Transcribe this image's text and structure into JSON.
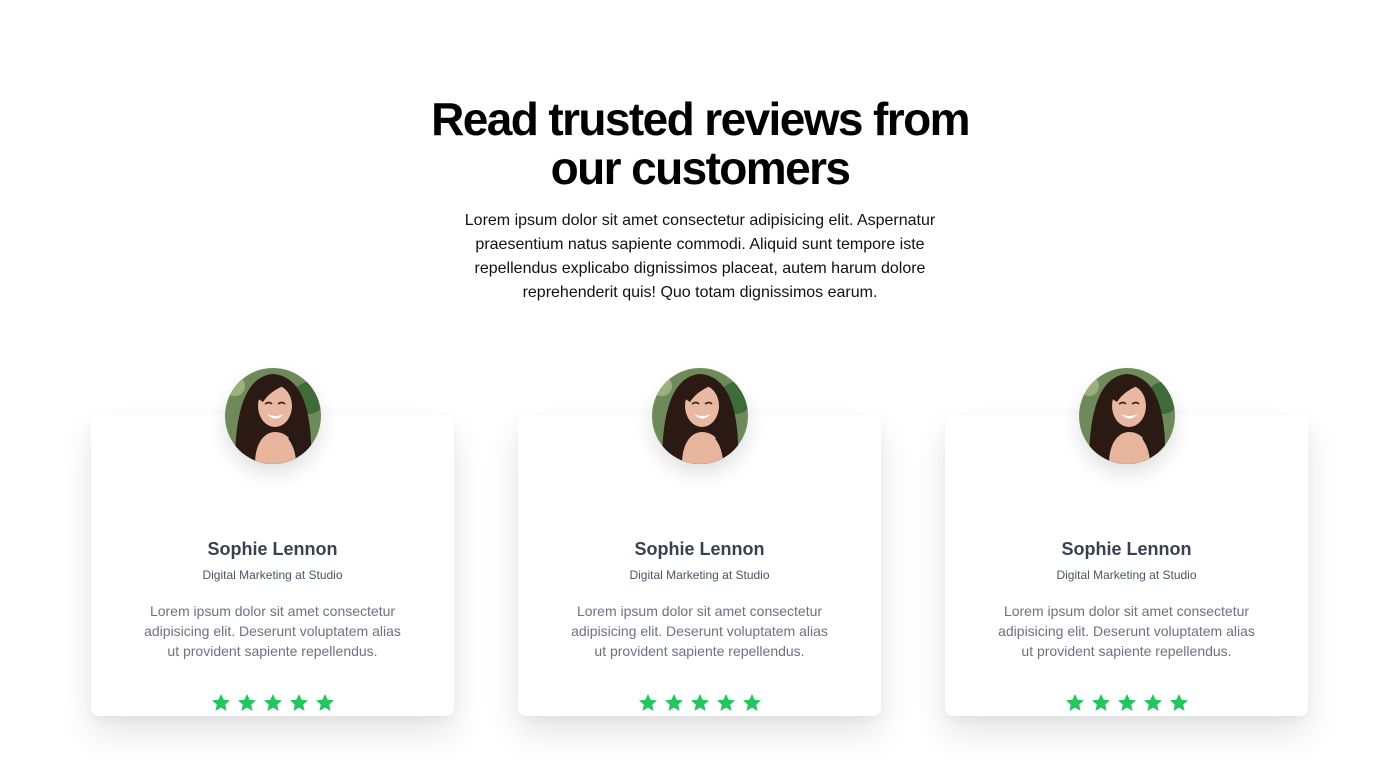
{
  "hero": {
    "title": "Read trusted reviews from our customers",
    "subtitle": "Lorem ipsum dolor sit amet consectetur adipisicing elit. Aspernatur praesentium natus sapiente commodi. Aliquid sunt tempore iste repellendus explicabo dignissimos placeat, autem harum dolore reprehenderit quis! Quo totam dignissimos earum."
  },
  "colors": {
    "star": "#22c55e",
    "name": "#374151",
    "text": "#6b7280"
  },
  "reviews": [
    {
      "name": "Sophie Lennon",
      "role": "Digital Marketing at Studio",
      "text": "Lorem ipsum dolor sit amet consectetur adipisicing elit. Deserunt voluptatem alias ut provident sapiente repellendus.",
      "rating": 5,
      "avatar_icon": "user-photo-avatar"
    },
    {
      "name": "Sophie Lennon",
      "role": "Digital Marketing at Studio",
      "text": "Lorem ipsum dolor sit amet consectetur adipisicing elit. Deserunt voluptatem alias ut provident sapiente repellendus.",
      "rating": 5,
      "avatar_icon": "user-photo-avatar"
    },
    {
      "name": "Sophie Lennon",
      "role": "Digital Marketing at Studio",
      "text": "Lorem ipsum dolor sit amet consectetur adipisicing elit. Deserunt voluptatem alias ut provident sapiente repellendus.",
      "rating": 5,
      "avatar_icon": "user-photo-avatar"
    }
  ]
}
